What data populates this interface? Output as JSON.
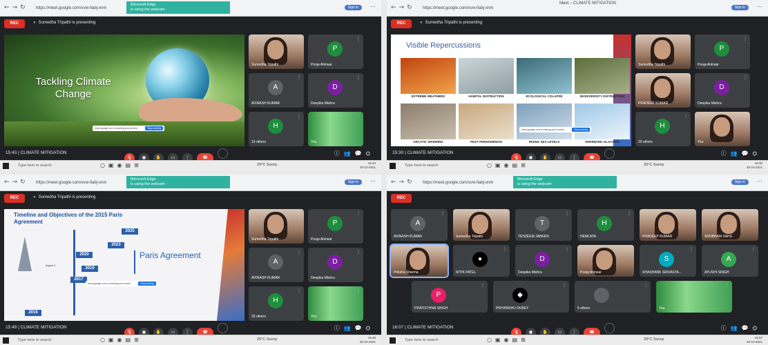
{
  "browser": {
    "url": "https://meet.google.com/xvw-fiabj-xnm",
    "sign_in": "Sign in",
    "toast_line1": "Microsoft Edge",
    "toast_line2": "is using the webcam",
    "tab_title": "Meet – CLIMATE MITIGATION"
  },
  "meeting": {
    "rec_label": "REC",
    "presenting_text": "Sumedha Tripathi is presenting",
    "meeting_name": "CLIMATE MITIGATION"
  },
  "screens": [
    {
      "time": "15:43",
      "slide_title": "Tackling Climate Change",
      "share_text": "meet.google.com is sharing your screen.",
      "share_button": "Stop sharing",
      "participants": [
        {
          "name": "Sumedha Tripathi",
          "type": "video"
        },
        {
          "name": "Pooja Ahirwar",
          "initial": "P",
          "color": "#1e8e3e"
        },
        {
          "name": "AVINASH KUMAR",
          "initial": "A",
          "color": "#5f6368"
        },
        {
          "name": "Deepika Mishra",
          "initial": "D",
          "color": "#7b1fa2"
        },
        {
          "name": "19 others",
          "initial": "H",
          "color": "#1e8e3e"
        },
        {
          "name": "You",
          "type": "green"
        }
      ]
    },
    {
      "time": "15:30",
      "slide_title": "Visible Repercussions",
      "share_text": "meet.google.com is sharing your screen.",
      "share_button": "Stop sharing",
      "captions": [
        "EXTREME WEATHERS",
        "HABITAL DISTRUCTION",
        "ECOLOGICAL COLAPSE",
        "BIODIVERSITY DISTRUCTION",
        "ARCATIC WARMING",
        "PEST PHENOMENON",
        "RISING SEA LEVELS",
        "SHRINKING GLACIERS"
      ],
      "participants": [
        {
          "name": "Sumedha Tripathi",
          "type": "video"
        },
        {
          "name": "Pooja Ahirwar",
          "initial": "P",
          "color": "#1e8e3e"
        },
        {
          "name": "PRADEEP KUMAR",
          "type": "video"
        },
        {
          "name": "Deepika Mishra",
          "initial": "D",
          "color": "#7b1fa2"
        },
        {
          "name": "20 others",
          "initial": "H",
          "color": "#1e8e3e"
        },
        {
          "name": "You",
          "type": "video"
        }
      ]
    },
    {
      "time": "15:49",
      "slide_title": "Timeline and Objectives of the 2015 Paris Agreement",
      "slide_subtitle": "Paris Agreement",
      "share_text": "meet.google.com is sharing your screen.",
      "share_button": "Stop sharing",
      "years": [
        "2025",
        "2023",
        "2020",
        "2019",
        "2017",
        "2016"
      ],
      "august": "August 4",
      "participants": [
        {
          "name": "Sumedha Tripathi",
          "type": "video"
        },
        {
          "name": "Pooja Ahirwar",
          "initial": "P",
          "color": "#1e8e3e"
        },
        {
          "name": "AVINASH KUMAR",
          "initial": "A",
          "color": "#5f6368"
        },
        {
          "name": "Deepika Mishra",
          "initial": "D",
          "color": "#7b1fa2"
        },
        {
          "name": "20 others",
          "initial": "H",
          "color": "#1e8e3e"
        },
        {
          "name": "You",
          "type": "green"
        }
      ]
    },
    {
      "time": "16:07",
      "participants": [
        {
          "name": "AVINASH KUMAR",
          "initial": "A",
          "color": "#5f6368"
        },
        {
          "name": "Sumedha Tripathi",
          "type": "video"
        },
        {
          "name": "TEHZEEM JABEEN",
          "initial": "T",
          "color": "#5f6368"
        },
        {
          "name": "HEMLATA",
          "initial": "H",
          "color": "#1e8e3e"
        },
        {
          "name": "PRADEEP KUMAR",
          "type": "video"
        },
        {
          "name": "SHUBHAM SAHU",
          "type": "video"
        },
        {
          "name": "Priksha Sharma",
          "type": "video",
          "highlight": true
        },
        {
          "name": "RITIK PATEL",
          "initial": "●",
          "color": "#000000"
        },
        {
          "name": "Deepika Mishra",
          "initial": "D",
          "color": "#7b1fa2"
        },
        {
          "name": "Pooja Ahirwar",
          "type": "video"
        },
        {
          "name": "SHASHANK SRIVASTA...",
          "initial": "S",
          "color": "#00acc1"
        },
        {
          "name": "AYUSHI SINGH",
          "initial": "A",
          "color": "#34a853"
        },
        {
          "name": "PRATISTHNA SINGH",
          "initial": "P",
          "color": "#e91e63"
        },
        {
          "name": "PRIYANSHU DUBEY",
          "initial": "◆",
          "color": "#000000"
        },
        {
          "name": "5 others",
          "initial": "",
          "color": "#5f6368"
        },
        {
          "name": "You",
          "type": "green"
        }
      ]
    }
  ],
  "taskbar": {
    "search_placeholder": "Type here to search",
    "weather": "29°C Sunny",
    "lang": "ENG",
    "clocks": [
      "15:43",
      "15:30",
      "15:49",
      "16:07"
    ],
    "date": "30-10-2021"
  }
}
